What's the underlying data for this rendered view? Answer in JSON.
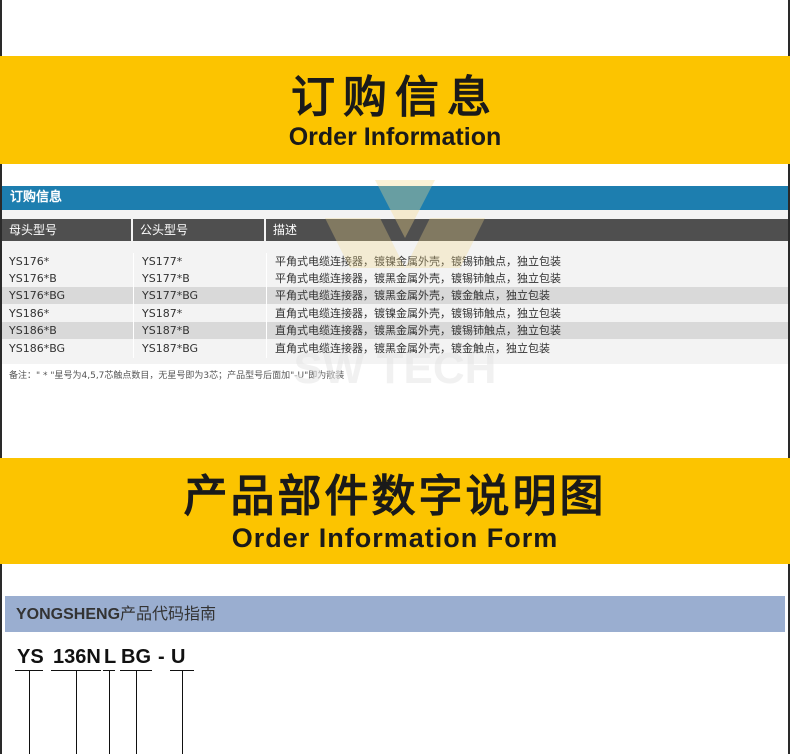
{
  "banner1": {
    "cn": "订购信息",
    "en": "Order Information"
  },
  "table": {
    "heading": "订购信息",
    "columns": [
      "母头型号",
      "公头型号",
      "描述"
    ],
    "rows": [
      {
        "female": "YS176*",
        "male": "YS177*",
        "desc": "平角式电缆连接器，镀镍金属外壳，镀锡铈触点，独立包装"
      },
      {
        "female": "YS176*B",
        "male": "YS177*B",
        "desc": "平角式电缆连接器，镀黑金属外壳，镀锡铈触点，独立包装"
      },
      {
        "female": "YS176*BG",
        "male": "YS177*BG",
        "desc": "平角式电缆连接器，镀黑金属外壳，镀金触点，独立包装"
      },
      {
        "female": "YS186*",
        "male": "YS187*",
        "desc": "直角式电缆连接器，镀镍金属外壳，镀锡铈触点，独立包装"
      },
      {
        "female": "YS186*B",
        "male": "YS187*B",
        "desc": "直角式电缆连接器，镀黑金属外壳，镀锡铈触点，独立包装"
      },
      {
        "female": "YS186*BG",
        "male": "YS187*BG",
        "desc": "直角式电缆连接器，镀黑金属外壳，镀金触点，独立包装"
      }
    ],
    "note": "备注：\" * \"星号为4,5,7芯触点数目，无星号即为3芯；产品型号后面加\"-U\"即为散装"
  },
  "watermark_text": "SW TECH",
  "banner2": {
    "cn": "产品部件数字说明图",
    "en": "Order Information Form"
  },
  "guide": {
    "brand": "YONGSHENG",
    "title": "产品代码指南"
  },
  "code_parts": [
    "YS",
    "136N",
    "L",
    "BG",
    "-",
    "U"
  ],
  "colors": {
    "yellow": "#fcc400",
    "blue": "#1d7eaf",
    "header_gray": "#4f4f4f",
    "guide_bar": "#9aaed0"
  }
}
